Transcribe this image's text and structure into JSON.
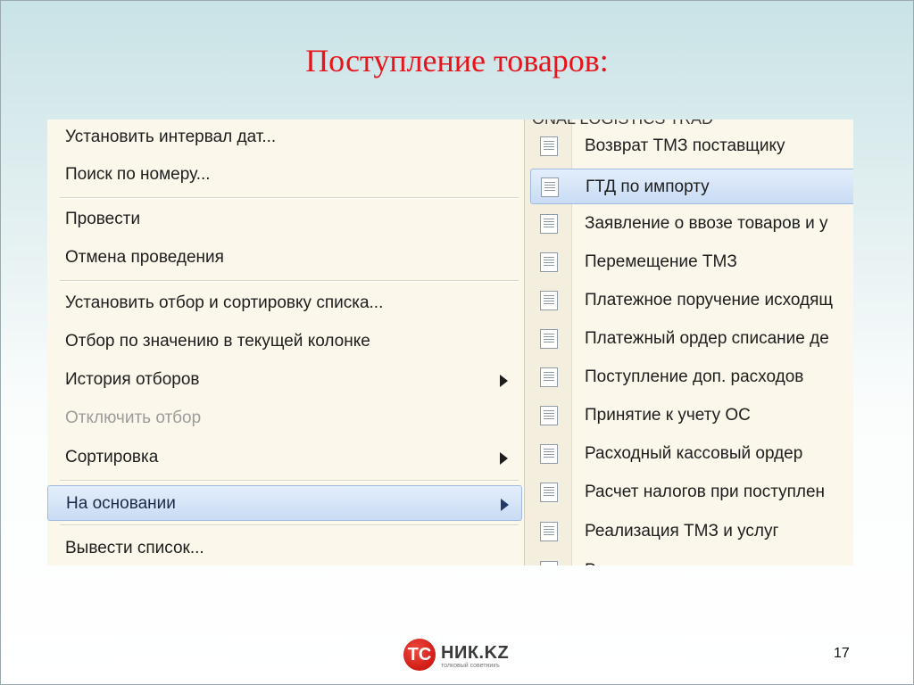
{
  "slide": {
    "title": "Поступление товаров:",
    "page_number": "17"
  },
  "logo": {
    "mark": "TC",
    "text": "НИК.KZ",
    "tagline": "толковый советникъ"
  },
  "context_menu": {
    "items": [
      {
        "label": "Установить интервал дат...",
        "enabled": true,
        "submenu": false
      },
      {
        "label": "Поиск по номеру...",
        "enabled": true,
        "submenu": false
      },
      {
        "label": "Провести",
        "enabled": true,
        "submenu": false
      },
      {
        "label": "Отмена проведения",
        "enabled": true,
        "submenu": false
      },
      {
        "label": "Установить отбор и сортировку списка...",
        "enabled": true,
        "submenu": false
      },
      {
        "label": "Отбор по значению в текущей колонке",
        "enabled": true,
        "submenu": false
      },
      {
        "label": "История отборов",
        "enabled": true,
        "submenu": true
      },
      {
        "label": "Отключить отбор",
        "enabled": false,
        "submenu": false
      },
      {
        "label": "Сортировка",
        "enabled": true,
        "submenu": true
      },
      {
        "label": "На основании",
        "enabled": true,
        "submenu": true,
        "selected": true
      },
      {
        "label": "Вывести список...",
        "enabled": true,
        "submenu": false
      }
    ]
  },
  "submenu": {
    "header": "ONAL LOGISTICS TRAD",
    "items": [
      {
        "label": "Возврат ТМЗ поставщику",
        "icon": "document-icon"
      },
      {
        "label": "ГТД по импорту",
        "icon": "document-icon",
        "selected": true
      },
      {
        "label": "Заявление о ввозе товаров и у",
        "icon": "document-icon"
      },
      {
        "label": "Перемещение ТМЗ",
        "icon": "document-icon"
      },
      {
        "label": "Платежное поручение исходящ",
        "icon": "document-icon"
      },
      {
        "label": "Платежный ордер списание де",
        "icon": "document-icon"
      },
      {
        "label": "Поступление доп. расходов",
        "icon": "document-icon"
      },
      {
        "label": "Принятие к учету ОС",
        "icon": "document-icon"
      },
      {
        "label": "Расходный кассовый ордер",
        "icon": "document-icon"
      },
      {
        "label": "Расчет налогов при поступлен",
        "icon": "document-icon"
      },
      {
        "label": "Реализация ТМЗ и услуг",
        "icon": "document-icon"
      },
      {
        "label": "Р",
        "icon": "document-icon"
      }
    ]
  }
}
